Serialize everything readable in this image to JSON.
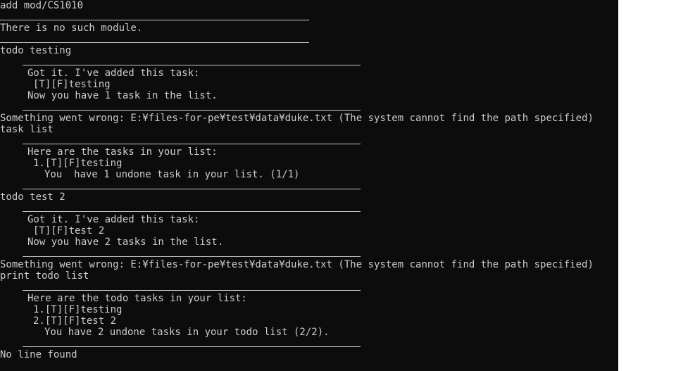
{
  "terminal": {
    "lines": [
      "add mod/CS1010",
      "",
      "There is no such module.",
      "",
      "todo testing",
      "",
      "Got it. I've added this task:",
      "[T][F]testing",
      "Now you have 1 task in the list.",
      "",
      "Something went wrong: E:¥files-for-pe¥test¥data¥duke.txt (The system cannot find the path specified)",
      "task list",
      "",
      "Here are the tasks in your list:",
      "1.[T][F]testing",
      "You  have 1 undone task in your list. (1/1)",
      "",
      "todo test 2",
      "",
      "Got it. I've added this task:",
      "[T][F]test 2",
      "Now you have 2 tasks in the list.",
      "",
      "Something went wrong: E:¥files-for-pe¥test¥data¥duke.txt (The system cannot find the path specified)",
      "print todo list",
      "",
      "Here are the todo tasks in your list:",
      "1.[T][F]testing",
      "2.[T][F]test 2",
      "You have 2 undone tasks in your todo list (2/2).",
      "",
      "No line found"
    ]
  }
}
